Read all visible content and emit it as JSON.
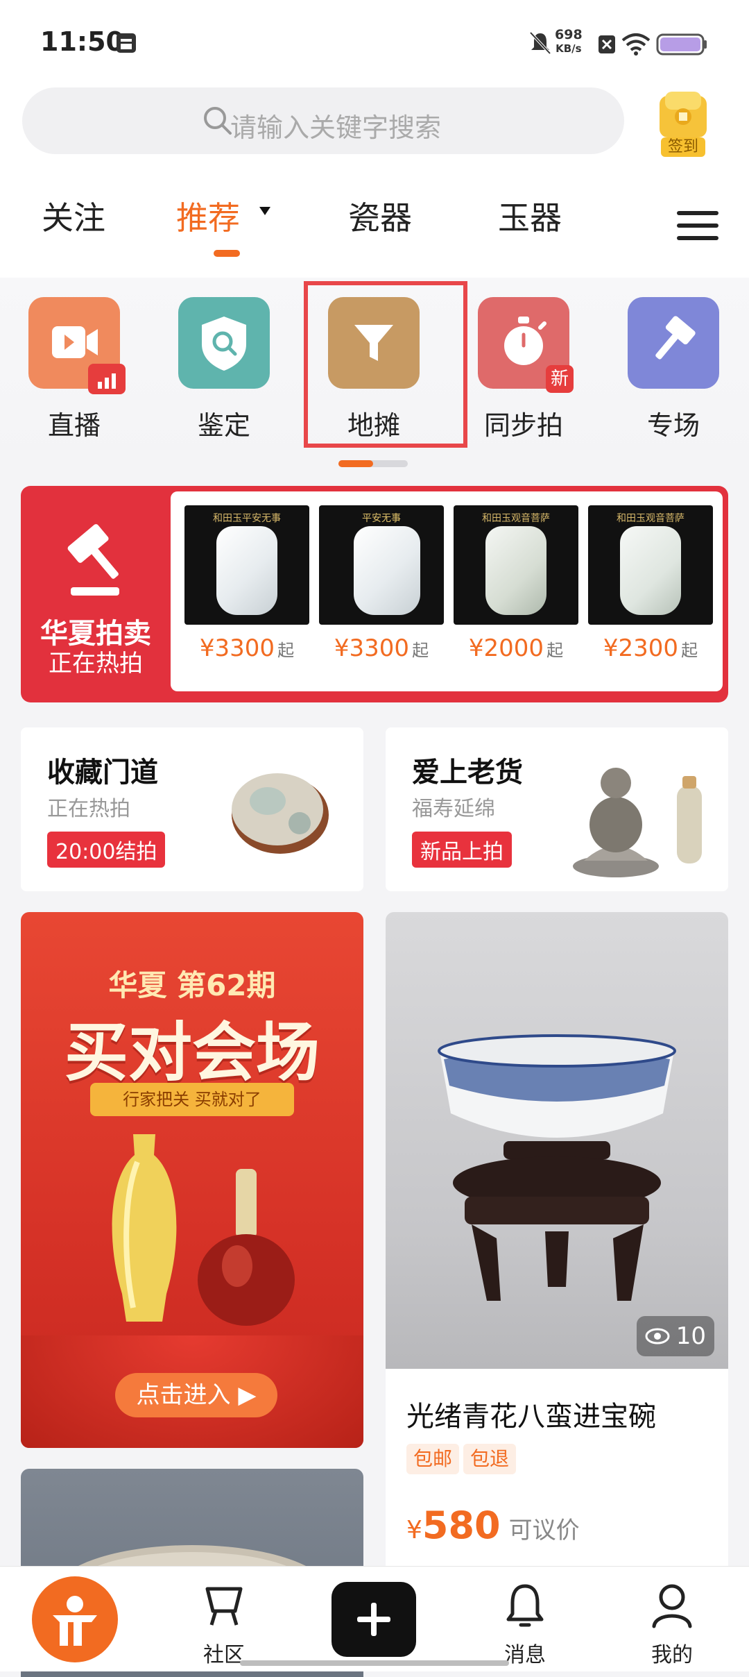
{
  "status_bar": {
    "time": "11:50",
    "net_speed_value": "698",
    "net_speed_unit": "KB/s"
  },
  "search": {
    "placeholder": "请输入关键字搜索"
  },
  "signin": {
    "label": "签到"
  },
  "tabs": [
    {
      "label": "关注"
    },
    {
      "label": "推荐"
    },
    {
      "label": "瓷器"
    },
    {
      "label": "玉器"
    }
  ],
  "categories": [
    {
      "label": "直播",
      "color": "#f08a5d",
      "icon": "video-camera-icon"
    },
    {
      "label": "鉴定",
      "color": "#5fb4ad",
      "icon": "shield-search-icon"
    },
    {
      "label": "地摊",
      "color": "#c79a63",
      "icon": "filter-icon"
    },
    {
      "label": "同步拍",
      "color": "#df6a6a",
      "icon": "stopwatch-icon",
      "badge": "新"
    },
    {
      "label": "专场",
      "color": "#7f87d8",
      "icon": "gavel-icon"
    }
  ],
  "auction": {
    "brand": "华夏拍卖",
    "subtitle": "正在热拍",
    "items": [
      {
        "price": "¥3300",
        "suffix": "起",
        "caption": "和田玉平安无事"
      },
      {
        "price": "¥3300",
        "suffix": "起",
        "caption": "平安无事"
      },
      {
        "price": "¥2000",
        "suffix": "起",
        "caption": "和田玉观音菩萨"
      },
      {
        "price": "¥2300",
        "suffix": "起",
        "caption": "和田玉观音菩萨"
      }
    ]
  },
  "mini_cards": [
    {
      "title": "收藏门道",
      "subtitle": "正在热拍",
      "badge": "20:00结拍"
    },
    {
      "title": "爱上老货",
      "subtitle": "福寿延绵",
      "badge": "新品上拍"
    }
  ],
  "promo": {
    "headline_small": "华夏 第62期",
    "headline": "买对会场",
    "ribbon": "行家把关 买就对了",
    "cta": "点击进入"
  },
  "product": {
    "title": "光绪青花八蛮进宝碗",
    "tags": [
      "包邮",
      "包退"
    ],
    "currency": "¥",
    "price": "580",
    "price_note": "可议价",
    "views": "10"
  },
  "bottom_nav": [
    {
      "label": "社区"
    },
    {
      "label": "消息"
    },
    {
      "label": "我的"
    }
  ],
  "colors": {
    "accent": "#f26b21",
    "auction_red": "#e2313d",
    "highlight": "#e8474a"
  }
}
